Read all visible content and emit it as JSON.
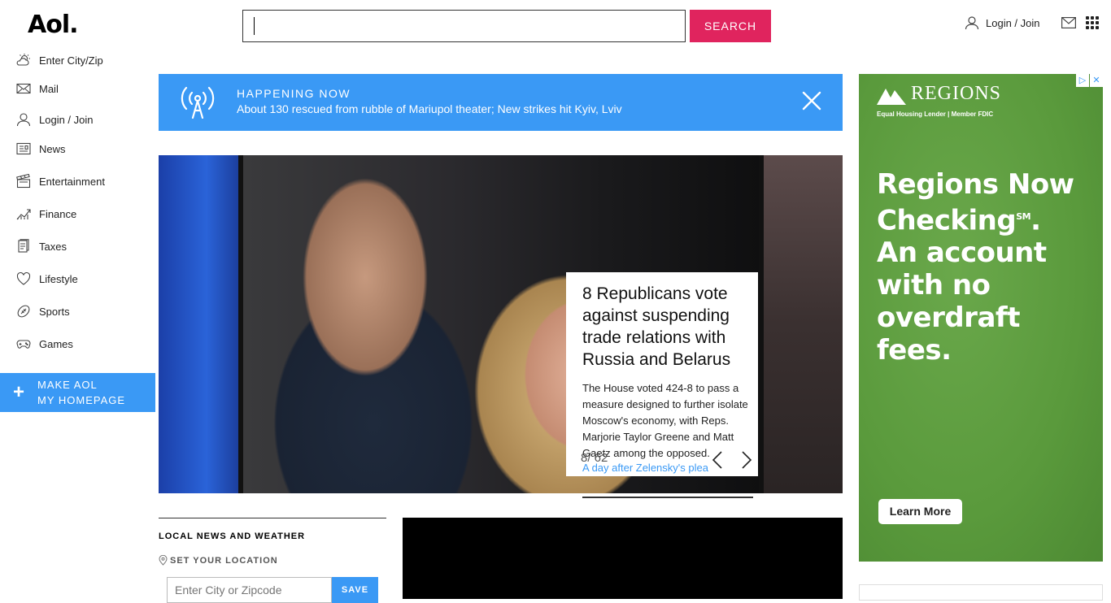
{
  "header": {
    "logo": "Aol.",
    "search_value": "",
    "search_button": "SEARCH",
    "login_label": "Login / Join"
  },
  "sidebar": {
    "items": [
      {
        "label": "Enter City/Zip",
        "icon": "weather-icon"
      },
      {
        "label": "Mail",
        "icon": "mail-icon"
      },
      {
        "label": "Login / Join",
        "icon": "user-icon"
      },
      {
        "label": "News",
        "icon": "news-icon"
      },
      {
        "label": "Entertainment",
        "icon": "clapper-icon"
      },
      {
        "label": "Finance",
        "icon": "chart-icon"
      },
      {
        "label": "Taxes",
        "icon": "tax-icon"
      },
      {
        "label": "Lifestyle",
        "icon": "heart-icon"
      },
      {
        "label": "Sports",
        "icon": "ball-icon"
      },
      {
        "label": "Games",
        "icon": "gamepad-icon"
      }
    ],
    "make_home_line1": "MAKE AOL",
    "make_home_line2": "MY HOMEPAGE"
  },
  "banner": {
    "kicker": "HAPPENING NOW",
    "headline": "About 130 rescued from rubble of Mariupol theater; New strikes hit Kyiv, Lviv"
  },
  "hero": {
    "title": "8 Republicans vote against suspending trade relations with Russia and Belarus",
    "description": "The House voted 424-8 to pass a measure designed to further isolate Moscow's economy, with Reps. Marjorie Taylor Greene and Matt Gaetz among the opposed.",
    "link": "A day after Zelensky's plea",
    "counter": "8/ 62"
  },
  "local": {
    "heading": "LOCAL NEWS AND WEATHER",
    "set_location": "SET YOUR LOCATION",
    "zip_placeholder": "Enter City or Zipcode",
    "save_button": "SAVE"
  },
  "ad": {
    "brand": "REGIONS",
    "sub": "Equal Housing Lender | Member FDIC",
    "line1": "Regions Now",
    "line2": "Checking",
    "line2_mark": "SM",
    "line3": "An account",
    "line4": "with no",
    "line5": "overdraft fees.",
    "cta": "Learn More",
    "adchoices": "▷",
    "close": "✕"
  },
  "colors": {
    "accent_blue": "#3a99f5",
    "search_pink": "#e0245e",
    "ad_green": "#5a9a3c"
  }
}
